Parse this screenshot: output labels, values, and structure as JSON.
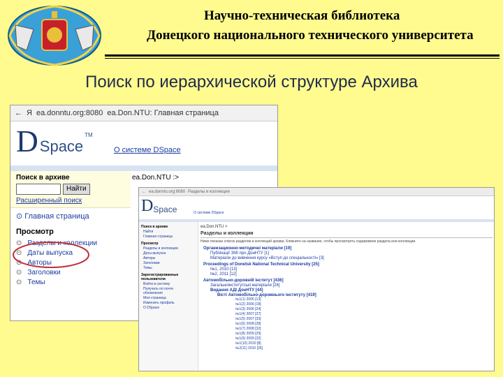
{
  "header": {
    "line1": "Научно-техническая библиотека",
    "line2": "Донецкого национального технического университета"
  },
  "slide_title": "Поиск по иерархической структуре Архива",
  "screenshot1": {
    "address_bar": {
      "back_glyph": "←",
      "lang": "Я",
      "url": "ea.donntu.org:8080",
      "tab_title": "ea.Don.NTU: Главная страница"
    },
    "logo": {
      "d": "D",
      "space": "Space",
      "tm": "TM"
    },
    "about_link": "О системе  DSpace",
    "breadcrumb": "ea.Don.NTU :>",
    "sidebar": {
      "search_title": "Поиск в архиве",
      "search_button": "Найти",
      "advanced_search": "Расширенный поиск",
      "main_page": "Главная страница",
      "browse_title": "Просмотр",
      "browse_items": [
        "Разделы и коллекции",
        "Даты выпуска",
        "Авторы",
        "Заголовки",
        "Темы"
      ]
    }
  },
  "screenshot2": {
    "logo": {
      "d": "D",
      "space": "Space"
    },
    "about_link": "О системе DSpace",
    "breadcrumb": "ea.Don.NTU >",
    "heading": "Разделы и коллекции",
    "intro": "Ниже показан список разделов и коллекций архива. Кликните на название, чтобы просмотреть содержимое раздела или коллекции.",
    "sidebar": {
      "search_title": "Поиск в архиве",
      "search_button": "Найти",
      "main_page": "Главная страница",
      "browse_title": "Просмотр",
      "browse_items": [
        "Разделы и коллекции",
        "Даты выпуска",
        "Авторы",
        "Заголовки",
        "Темы"
      ],
      "registered_title": "Зарегистрированные пользователи",
      "registered_items": [
        "Войти в систему",
        "Получать по почте обновления",
        "Моя страница",
        "Изменить профиль"
      ],
      "about_item": "О DSpace"
    },
    "tree": [
      {
        "level": 0,
        "text": "Организационно-методичні матеріали [19]"
      },
      {
        "level": 1,
        "text": "Публікації ЗМІ про ДонНТУ [1]"
      },
      {
        "level": 1,
        "text": "Матеріали до вивчення курсу «Вступ до спеціальності» [3]"
      },
      {
        "level": 0,
        "text": "Proceedings of Donetsk National Technical University [25]"
      },
      {
        "level": 1,
        "text": "№1, 2010 [13]"
      },
      {
        "level": 1,
        "text": "№2, 2011 [12]"
      },
      {
        "level": 0,
        "text": "Автомобільно-дорожній інститут [436]"
      },
      {
        "level": 1,
        "text": "Загальноінститутські матеріали [26]"
      },
      {
        "level": 2,
        "text": "Видання АДІ ДонНТУ [44]"
      },
      {
        "level": 3,
        "text": "Вісті Автомобільно-дорожнього інституту [419]"
      },
      {
        "level": 4,
        "text": "№1(1) 2005 [13]"
      },
      {
        "level": 4,
        "text": "№1(2) 2006 [18]"
      },
      {
        "level": 4,
        "text": "№1(3) 2006 [24]"
      },
      {
        "level": 4,
        "text": "№1(4) 2007 [37]"
      },
      {
        "level": 4,
        "text": "№1(5) 2007 [33]"
      },
      {
        "level": 4,
        "text": "№1(6) 2008 [28]"
      },
      {
        "level": 4,
        "text": "№1(7) 2008 [32]"
      },
      {
        "level": 4,
        "text": "№1(8) 2009 [29]"
      },
      {
        "level": 4,
        "text": "№1(9) 2009 [32]"
      },
      {
        "level": 4,
        "text": "№1(10) 2010 [8]"
      },
      {
        "level": 4,
        "text": "№2(11) 2010 [26]"
      }
    ]
  },
  "colors": {
    "background": "#fffb8f",
    "link": "#1a3aa0",
    "highlight_circle": "#c0303a",
    "title_text": "#1e2a4a"
  }
}
